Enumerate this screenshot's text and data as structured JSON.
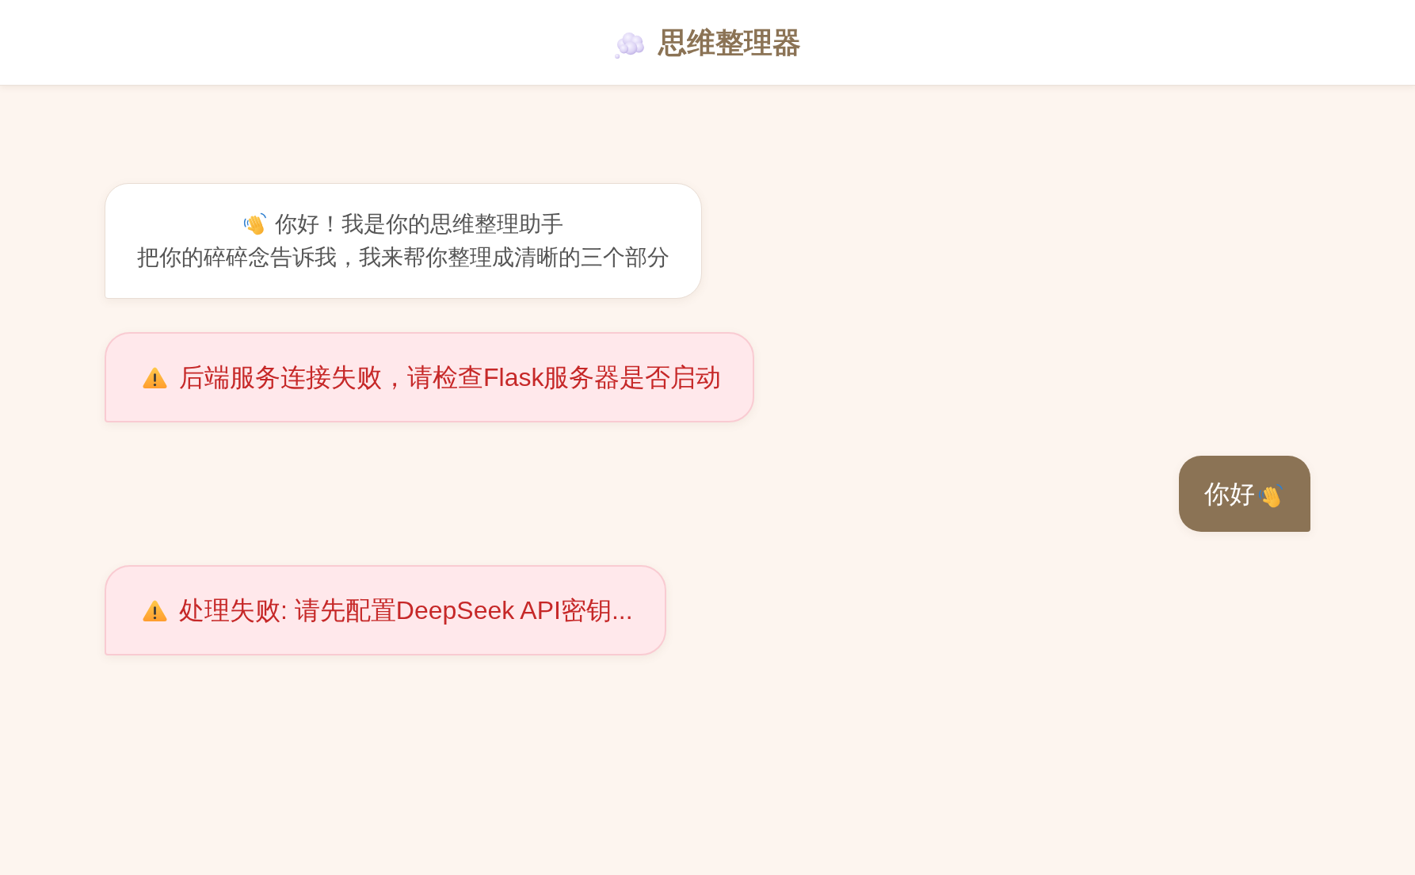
{
  "header": {
    "title": "思维整理器"
  },
  "messages": [
    {
      "kind": "welcome",
      "lines": [
        "你好！我是你的思维整理助手",
        "把你的碎碎念告诉我，我来帮你整理成清晰的三个部分"
      ]
    },
    {
      "kind": "error",
      "text": "后端服务连接失败，请检查Flask服务器是否启动"
    },
    {
      "kind": "user",
      "text": "你好"
    },
    {
      "kind": "error",
      "text": "处理失败: 请先配置DeepSeek API密钥..."
    }
  ]
}
